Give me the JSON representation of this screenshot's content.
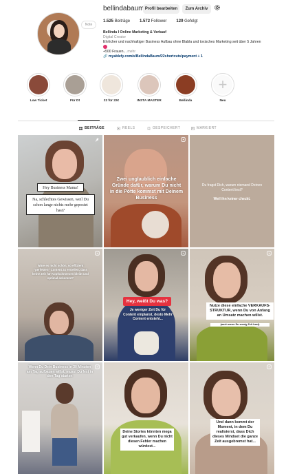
{
  "profile": {
    "username": "bellindabaum",
    "note_label": "Note",
    "edit_button": "Profil bearbeiten",
    "archive_button": "Zum Archiv",
    "stats": {
      "posts_count": "1.525",
      "posts_label": "Beiträge",
      "followers_count": "1.572",
      "followers_label": "Follower",
      "following_count": "129",
      "following_label": "Gefolgt"
    },
    "bio": {
      "name": "Bellinda I Online Marketing & Verkauf",
      "category": "Digital Creator",
      "text": "Ehrlicher und nachhaltiger Business Aufbau ohne Blabla und toxisches Marketing seit über 5 Jahren",
      "line3": "+500 Frauen...",
      "more": "mehr",
      "link": "myablefy.com/s/BellindaBaum/22shortcuts/payment + 1"
    }
  },
  "highlights": [
    {
      "label": "Low Ticket",
      "color": "#8a4a3a"
    },
    {
      "label": "Für Dt",
      "color": "#a99f95"
    },
    {
      "label": "22 für 22€",
      "color": "#efe6dc"
    },
    {
      "label": "INSTA MASTER",
      "color": "#dcc6bb"
    },
    {
      "label": "Bellinda",
      "color": "#8b3d23"
    },
    {
      "label": "Neu",
      "color": "#fafafa"
    }
  ],
  "tabs": [
    {
      "label": "BEITRÄGE",
      "active": true
    },
    {
      "label": "REELS",
      "active": false
    },
    {
      "label": "GESPEICHERT",
      "active": false
    },
    {
      "label": "MARKIERT",
      "active": false
    }
  ],
  "posts": [
    {
      "caption_a": "Hey Business Mama!",
      "caption_b": "Na, schlechtes Gewissen, weil Du schon lange nichts mehr gepostet hast?"
    },
    {
      "caption": "Zwei unglaublich einfache Gründe dafür, warum Du nicht in die Pötte kommst mit Deinem Business"
    },
    {
      "caption_a": "Du fragst Dich, warum niemand Deinen Content liest?",
      "caption_b": "Weil ihn keiner checkt."
    },
    {
      "caption_a": "Wäre es nicht schön, so effizient \"perfekten\" Content zu erstellen, dass keine Zeit für Kopfschmerzen bleibt und optimal ankommt?",
      "caption_b": ""
    },
    {
      "caption_a": "Hey, weißt Du was?",
      "caption_b": "Je weniger Zeit Du für Content einplanst, desto Mehr Content entsteht..."
    },
    {
      "caption": "Nutze diese einfache VERKAUFS-STRUKTUR, wenn Du von Anfang an Umsatz machen willst.",
      "caption_b": "(auch wenn Du wenig Zeit hast)"
    },
    {
      "caption": "Wenn Du Dein Business in 30 Minuten am Tag aufbauen willst, musst Du fest in den Tag starten"
    },
    {
      "caption": "Deine Stories könnten mega gut verkaufen, wenn Du nicht diesen Fehler machen würdest..."
    },
    {
      "caption": "Und dann kommt der Moment, in dem Du realisierst, dass Dich dieses Mindset die ganze Zeit ausgebremst hat..."
    }
  ]
}
